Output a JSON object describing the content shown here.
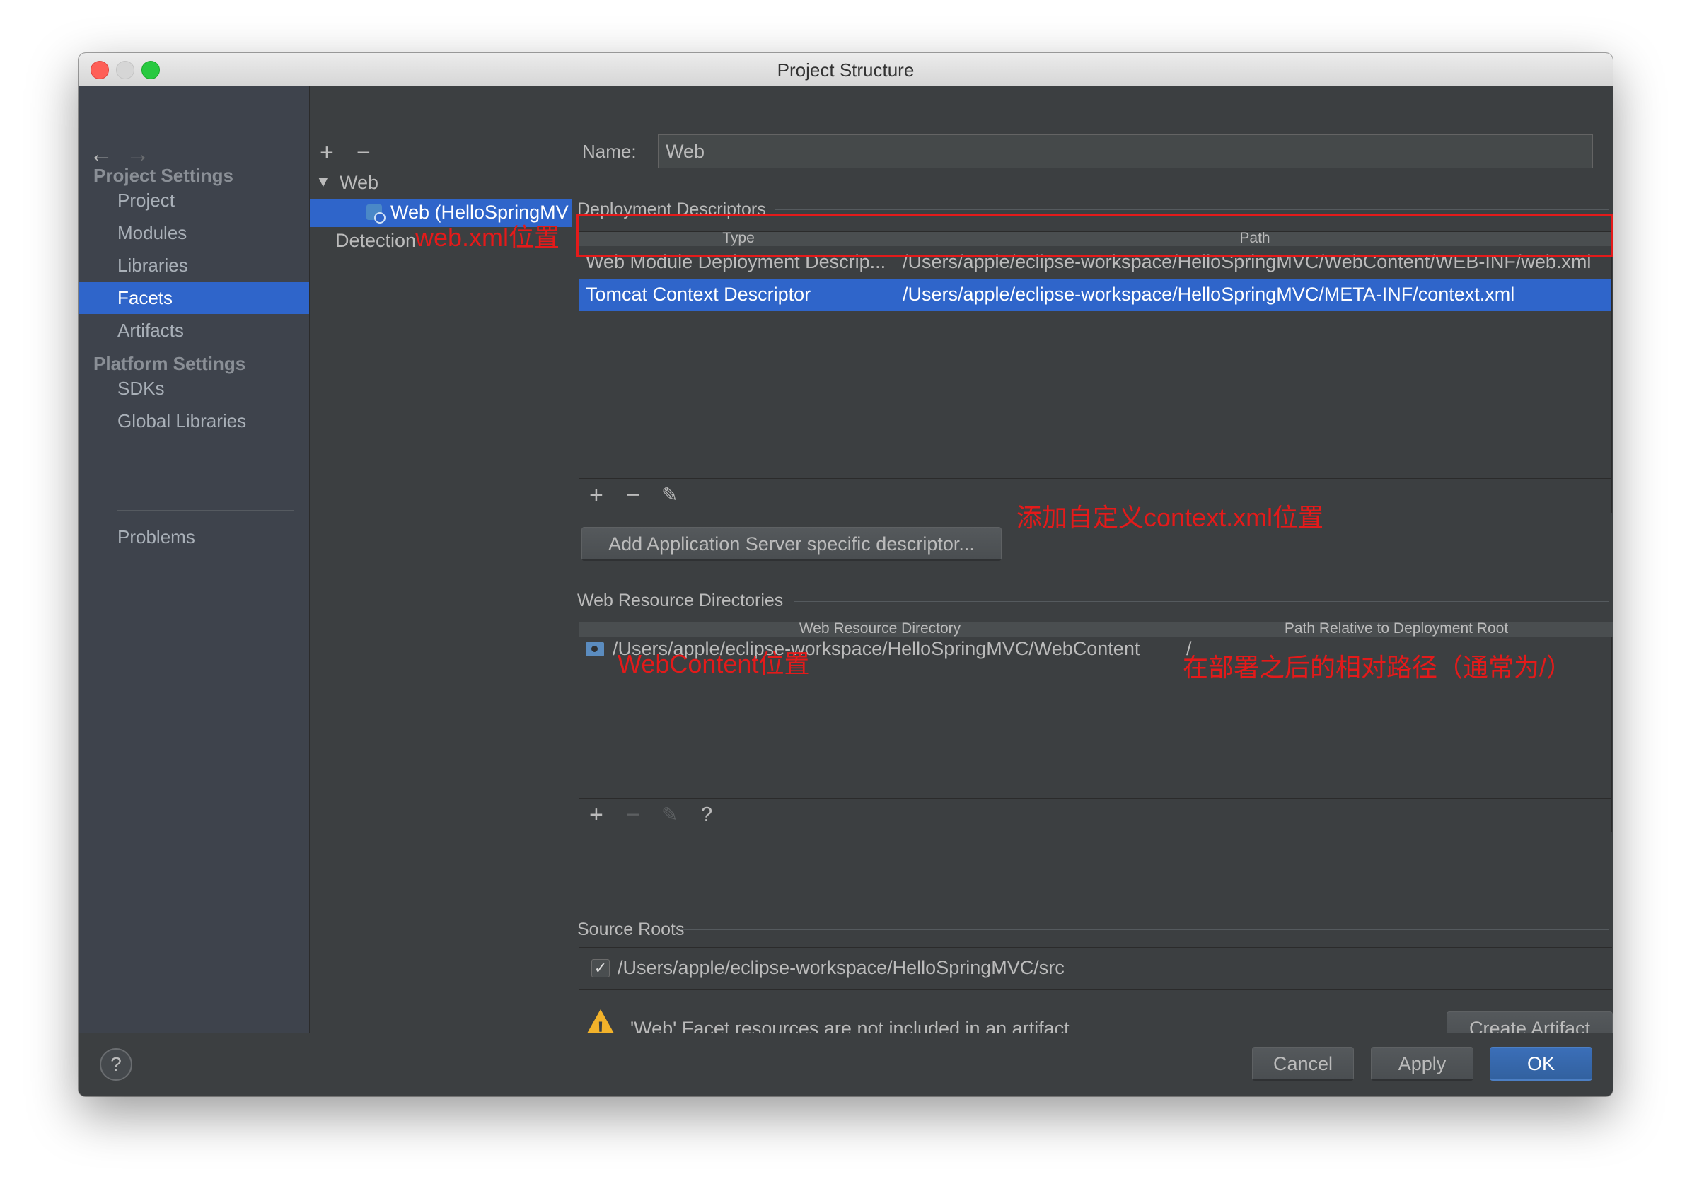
{
  "window": {
    "title": "Project Structure"
  },
  "nav": {
    "sections": [
      {
        "label": "Project Settings",
        "items": [
          "Project",
          "Modules",
          "Libraries",
          "Facets",
          "Artifacts"
        ]
      },
      {
        "label": "Platform Settings",
        "items": [
          "SDKs",
          "Global Libraries"
        ]
      }
    ],
    "problems": "Problems",
    "selected": "Facets"
  },
  "tree": {
    "add": "+",
    "remove": "−",
    "web_group": "Web",
    "web_facet": "Web (HelloSpringMV",
    "detection": "Detection"
  },
  "facet": {
    "name_label": "Name:",
    "name_value": "Web",
    "deployment": {
      "title": "Deployment Descriptors",
      "columns": [
        "Type",
        "Path"
      ],
      "rows": [
        {
          "type": "Web Module Deployment Descrip...",
          "path": "/Users/apple/eclipse-workspace/HelloSpringMVC/WebContent/WEB-INF/web.xml"
        },
        {
          "type": "Tomcat Context Descriptor",
          "path": "/Users/apple/eclipse-workspace/HelloSpringMVC/META-INF/context.xml"
        }
      ],
      "add_server_button": "Add Application Server specific descriptor..."
    },
    "web_resources": {
      "title": "Web Resource Directories",
      "columns": [
        "Web Resource Directory",
        "Path Relative to Deployment Root"
      ],
      "rows": [
        {
          "dir": "/Users/apple/eclipse-workspace/HelloSpringMVC/WebContent",
          "rel": "/"
        }
      ]
    },
    "source_roots": {
      "title": "Source Roots",
      "path": "/Users/apple/eclipse-workspace/HelloSpringMVC/src",
      "checked": true
    },
    "warning": "'Web' Facet resources are not included in an artifact",
    "create_artifact": "Create Artifact"
  },
  "toolbar_icons": {
    "add": "+",
    "remove": "−",
    "help": "?"
  },
  "footer": {
    "help": "?",
    "cancel": "Cancel",
    "apply": "Apply",
    "ok": "OK"
  },
  "annotations": {
    "web_xml": "web.xml位置",
    "context_xml": "添加自定义context.xml位置",
    "webcontent": "WebContent位置",
    "relative": "在部署之后的相对路径（通常为/）",
    "color": "#e41a1a"
  },
  "colors": {
    "accent": "#2f65ca",
    "background": "#3c3f41",
    "warning": "#f2b22a"
  }
}
